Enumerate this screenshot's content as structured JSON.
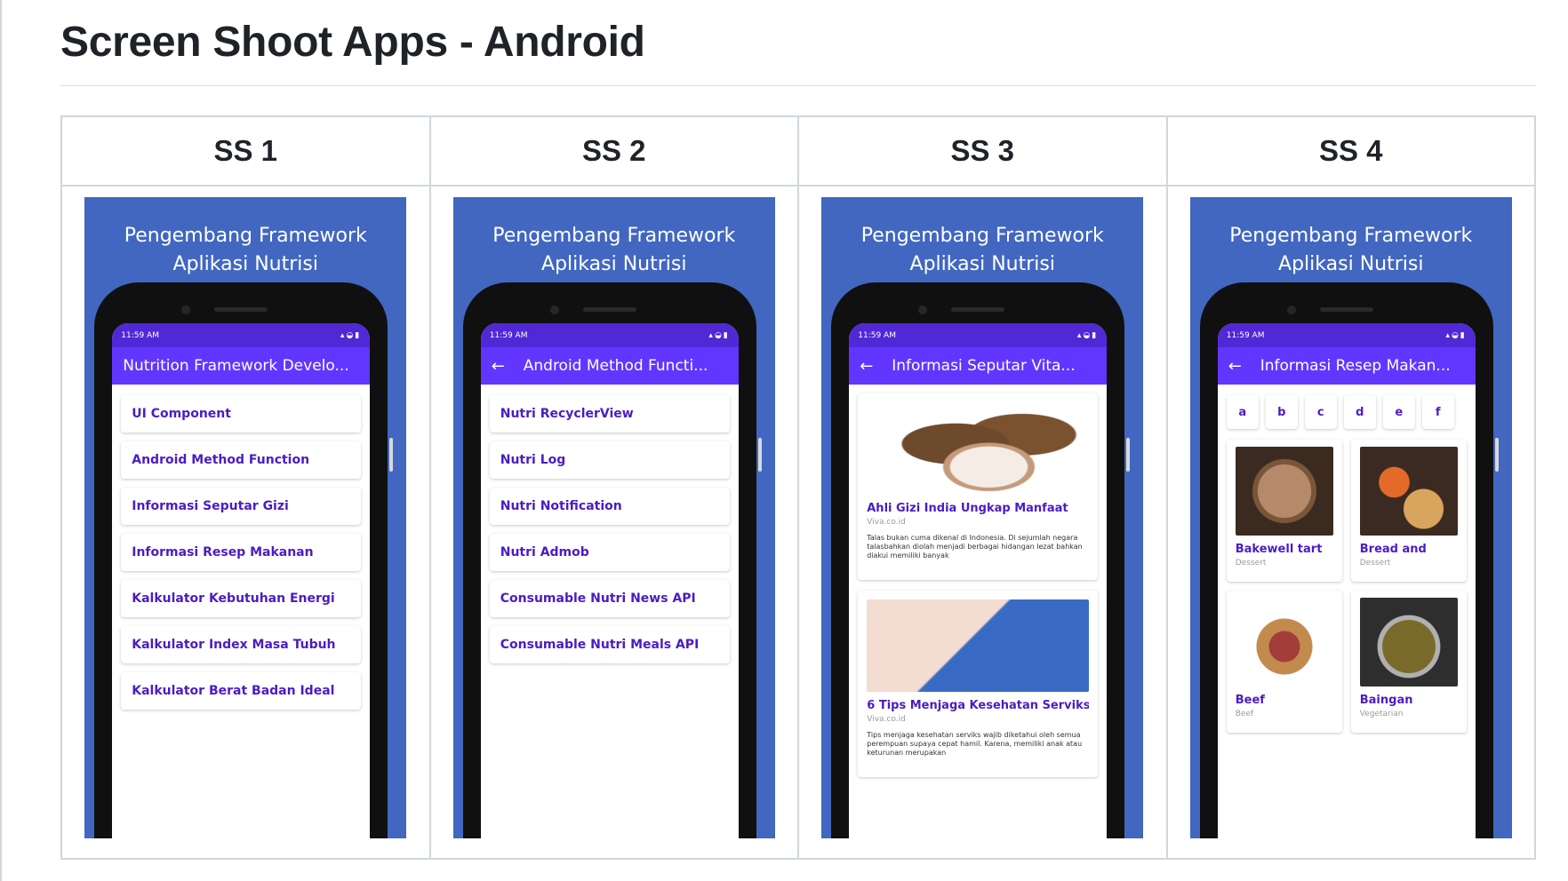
{
  "page": {
    "title": "Screen Shoot Apps - Android"
  },
  "colors": {
    "shot_bg": "#4267c0",
    "appbar": "#6236ff",
    "statusbar": "#5128d6",
    "accent_text": "#4b1cc4"
  },
  "columns": [
    {
      "header": "SS 1"
    },
    {
      "header": "SS 2"
    },
    {
      "header": "SS 3"
    },
    {
      "header": "SS 4"
    }
  ],
  "shot_title": {
    "line1": "Pengembang Framework",
    "line2": "Aplikasi Nutrisi"
  },
  "status": {
    "time": "11:59 AM"
  },
  "ss1": {
    "appbar_title": "Nutrition Framework Develo...",
    "items": [
      "UI Component",
      "Android Method Function",
      "Informasi Seputar Gizi",
      "Informasi Resep Makanan",
      "Kalkulator Kebutuhan Energi",
      "Kalkulator Index Masa Tubuh",
      "Kalkulator Berat Badan Ideal"
    ]
  },
  "ss2": {
    "appbar_title": "Android Method Functi...",
    "items": [
      "Nutri RecyclerView",
      "Nutri Log",
      "Nutri Notification",
      "Nutri Admob",
      "Consumable Nutri News API",
      "Consumable Nutri Meals API"
    ]
  },
  "ss3": {
    "appbar_title": "Informasi Seputar Vita...",
    "news": [
      {
        "title": "Ahli Gizi India Ungkap Manfaat",
        "source": "Viva.co.id",
        "desc": "Talas bukan cuma dikenal di Indonesia. Di sejumlah negara talasbahkan diolah menjadi berbagai hidangan lezat bahkan diakui memiliki banyak"
      },
      {
        "title": "6 Tips Menjaga Kesehatan Serviks",
        "source": "Viva.co.id",
        "desc": "Tips menjaga kesehatan serviks wajib diketahui oleh semua perempuan supaya cepat hamil. Karena, memiliki anak atau keturunan merupakan"
      }
    ]
  },
  "ss4": {
    "appbar_title": "Informasi Resep Makan...",
    "letters": [
      "a",
      "b",
      "c",
      "d",
      "e",
      "f"
    ],
    "meals": [
      {
        "name": "Bakewell tart",
        "category": "Dessert"
      },
      {
        "name": "Bread and",
        "category": "Dessert"
      },
      {
        "name": "Beef",
        "category": "Beef"
      },
      {
        "name": "Baingan",
        "category": "Vegetarian"
      }
    ]
  },
  "icons": {
    "back": "arrow-back-icon"
  }
}
